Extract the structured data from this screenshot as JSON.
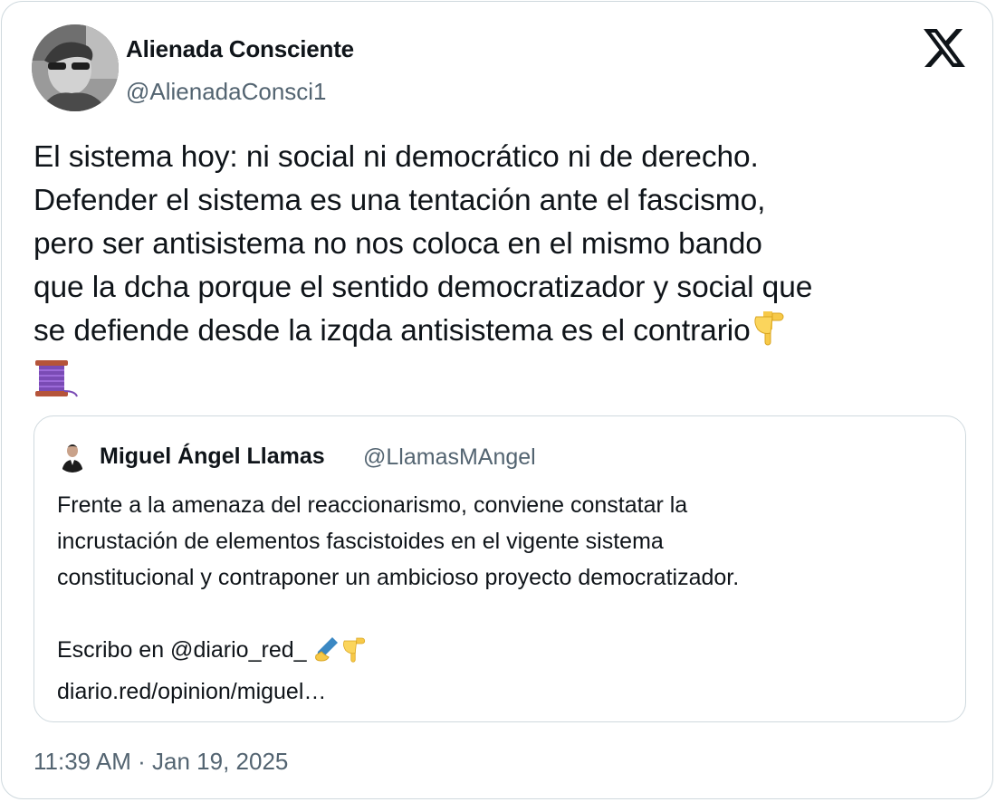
{
  "author": {
    "name": "Alienada Consciente",
    "handle": "@AlienadaConsci1"
  },
  "tweet": {
    "text": "El sistema hoy: ni social ni democrático ni de derecho.\nDefender el sistema es una tentación ante el fascismo,\npero ser antisistema no nos coloca en el mismo bando\nque la dcha porque el sentido democratizador y social que\nse defiende desde la izqda antisistema es el contrario",
    "emojis": [
      "pointing-down-emoji",
      "thread-spool-emoji"
    ]
  },
  "quoted_tweet": {
    "author_name": "Miguel Ángel Llamas",
    "author_handle": "@LlamasMAngel",
    "text": "Frente a la amenaza del reaccionarismo, conviene constatar la\nincrustación de elementos fascistoides en el vigente sistema\nconstitucional y contraponer un ambicioso proyecto democratizador.\n\nEscribo en @diario_red_ ",
    "link": "diario.red/opinion/miguel…"
  },
  "timestamp": "11:39 AM · Jan 19, 2025",
  "icons": {
    "platform_logo": "x-logo-icon"
  },
  "colors": {
    "text": "#0f1419",
    "secondary": "#536471",
    "border": "#cfd9de"
  }
}
